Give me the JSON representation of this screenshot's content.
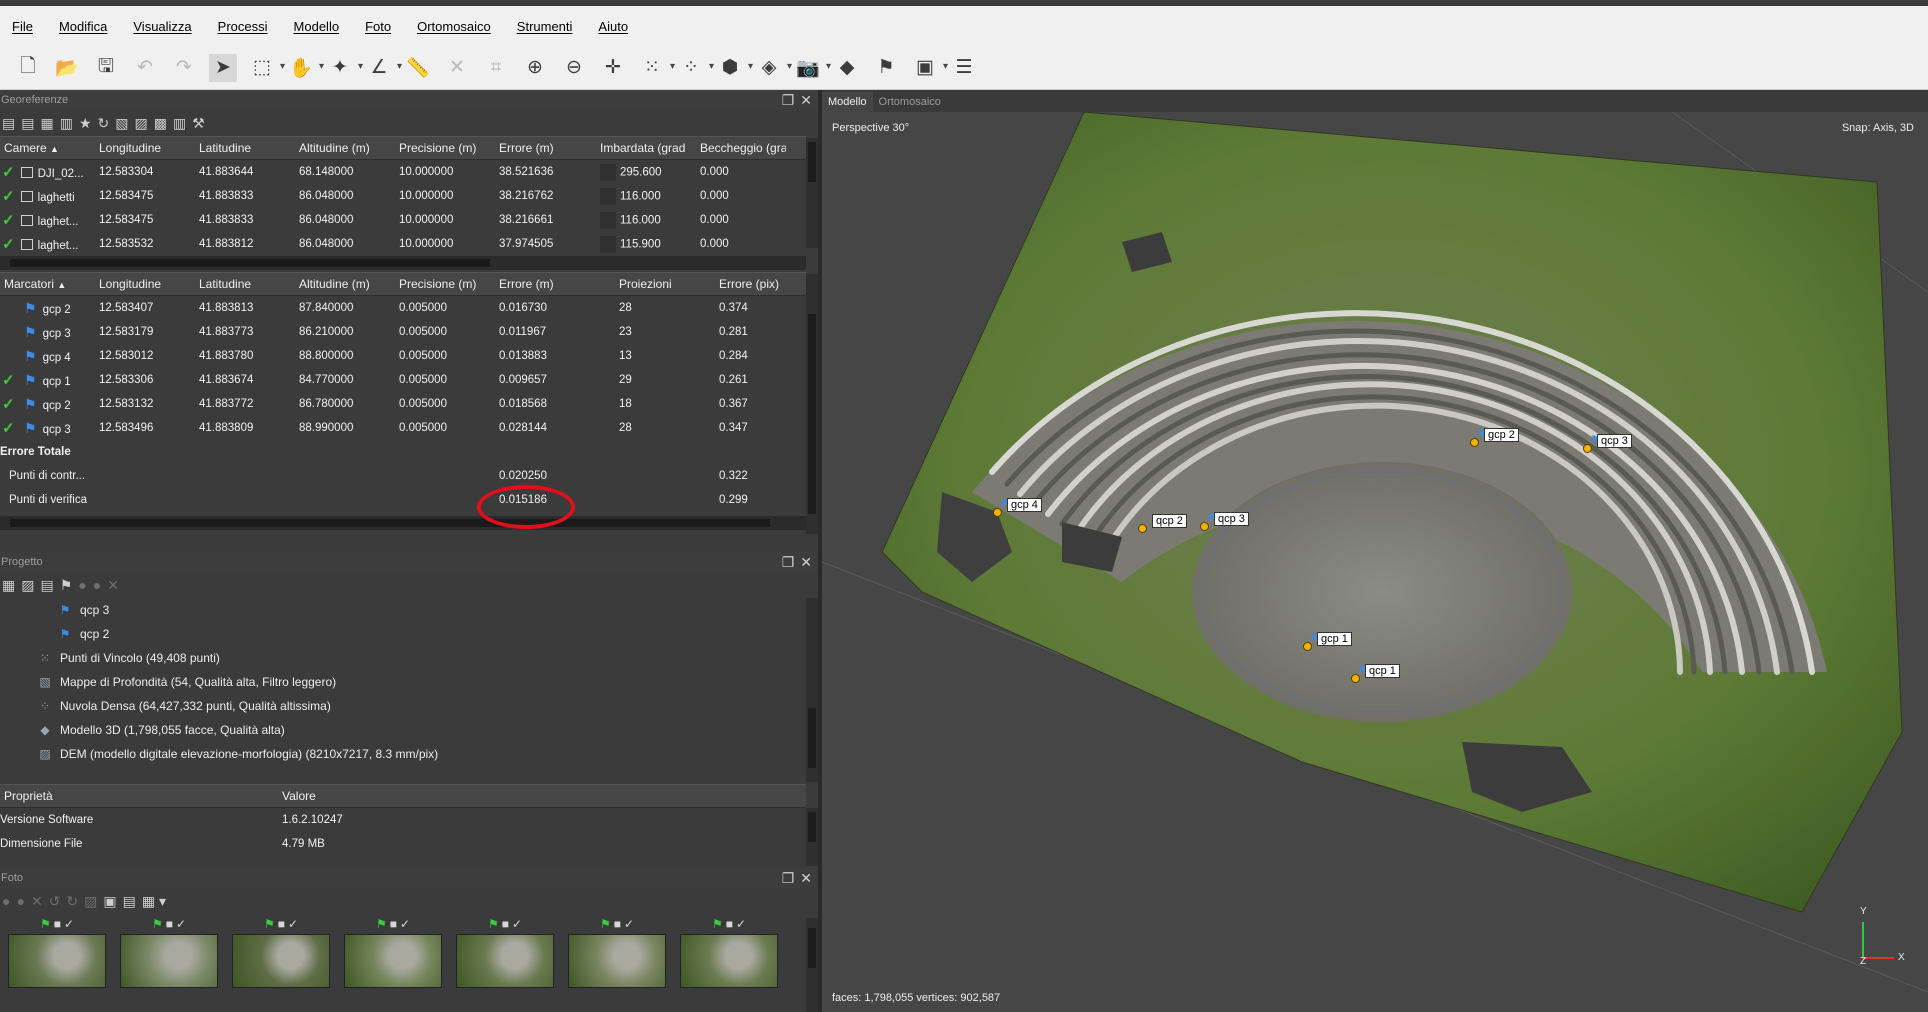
{
  "menu": [
    "File",
    "Modifica",
    "Visualizza",
    "Processi",
    "Modello",
    "Foto",
    "Ortomosaico",
    "Strumenti",
    "Aiuto"
  ],
  "toolbar_icons": [
    "new-file-icon",
    "open-folder-icon",
    "save-icon",
    "undo-icon",
    "redo-icon",
    "select-cursor-icon",
    "rectangle-select-icon",
    "hand-select-icon",
    "free-form-select-icon",
    "ruler-icon",
    "tape-measure-icon",
    "delete-icon",
    "crop-icon",
    "zoom-in-icon",
    "zoom-out-icon",
    "navigation-icon",
    "point-cloud-icon",
    "dense-cloud-icon",
    "mesh-shaded-icon",
    "mesh-wireframe-icon",
    "camera-icon",
    "ortho-icon",
    "markers-flag-icon",
    "dem-image-icon",
    "stack-icon"
  ],
  "georef": {
    "title": "Georeferenze",
    "cameras_headers": [
      "Camere",
      "Longitudine",
      "Latitudine",
      "Altitudine (m)",
      "Precisione (m)",
      "Errore (m)",
      "Imbardata (grad",
      "Beccheggio (gra"
    ],
    "cameras": [
      {
        "name": "DJI_02...",
        "lon": "12.583304",
        "lat": "41.883644",
        "alt": "68.148000",
        "prec": "10.000000",
        "err": "38.521636",
        "yaw": "295.600",
        "pitch": "0.000"
      },
      {
        "name": "laghetti",
        "lon": "12.583475",
        "lat": "41.883833",
        "alt": "86.048000",
        "prec": "10.000000",
        "err": "38.216762",
        "yaw": "116.000",
        "pitch": "0.000"
      },
      {
        "name": "laghet...",
        "lon": "12.583475",
        "lat": "41.883833",
        "alt": "86.048000",
        "prec": "10.000000",
        "err": "38.216661",
        "yaw": "116.000",
        "pitch": "0.000"
      },
      {
        "name": "laghet...",
        "lon": "12.583532",
        "lat": "41.883812",
        "alt": "86.048000",
        "prec": "10.000000",
        "err": "37.974505",
        "yaw": "115.900",
        "pitch": "0.000"
      }
    ],
    "markers_headers": [
      "Marcatori",
      "Longitudine",
      "Latitudine",
      "Altitudine (m)",
      "Precisione (m)",
      "Errore (m)",
      "Proiezioni",
      "Errore (pix)"
    ],
    "markers": [
      {
        "checked": false,
        "name": "gcp 2",
        "lon": "12.583407",
        "lat": "41.883813",
        "alt": "87.840000",
        "prec": "0.005000",
        "err": "0.016730",
        "proj": "28",
        "errpix": "0.374"
      },
      {
        "checked": false,
        "name": "gcp 3",
        "lon": "12.583179",
        "lat": "41.883773",
        "alt": "86.210000",
        "prec": "0.005000",
        "err": "0.011967",
        "proj": "23",
        "errpix": "0.281"
      },
      {
        "checked": false,
        "name": "gcp 4",
        "lon": "12.583012",
        "lat": "41.883780",
        "alt": "88.800000",
        "prec": "0.005000",
        "err": "0.013883",
        "proj": "13",
        "errpix": "0.284"
      },
      {
        "checked": true,
        "name": "qcp 1",
        "lon": "12.583306",
        "lat": "41.883674",
        "alt": "84.770000",
        "prec": "0.005000",
        "err": "0.009657",
        "proj": "29",
        "errpix": "0.261"
      },
      {
        "checked": true,
        "name": "qcp 2",
        "lon": "12.583132",
        "lat": "41.883772",
        "alt": "86.780000",
        "prec": "0.005000",
        "err": "0.018568",
        "proj": "18",
        "errpix": "0.367"
      },
      {
        "checked": true,
        "name": "qcp 3",
        "lon": "12.583496",
        "lat": "41.883809",
        "alt": "88.990000",
        "prec": "0.005000",
        "err": "0.028144",
        "proj": "28",
        "errpix": "0.347"
      }
    ],
    "total_label": "Errore Totale",
    "totals": [
      {
        "label": "Punti di contr...",
        "err": "0.020250",
        "errpix": "0.322"
      },
      {
        "label": "Punti di verifica",
        "err": "0.015186",
        "errpix": "0.299"
      }
    ]
  },
  "project": {
    "title": "Progetto",
    "items": [
      {
        "text": "qcp 3",
        "icon": "marker-flag-icon"
      },
      {
        "text": "qcp 2",
        "icon": "marker-flag-icon"
      },
      {
        "text": "Punti di Vincolo (49,408 punti)",
        "icon": "tie-points-icon"
      },
      {
        "text": "Mappe di Profondità (54, Qualità alta, Filtro leggero)",
        "icon": "depth-maps-icon"
      },
      {
        "text": "Nuvola Densa (64,427,332 punti, Qualità altissima)",
        "icon": "dense-cloud-icon"
      },
      {
        "text": "Modello 3D (1,798,055 facce, Qualità alta)",
        "icon": "model-icon"
      },
      {
        "text": "DEM (modello digitale elevazione-morfologia) (8210x7217, 8.3 mm/pix)",
        "icon": "dem-icon"
      }
    ]
  },
  "properties": {
    "headers": [
      "Proprietà",
      "Valore"
    ],
    "rows": [
      {
        "k": "Versione Software",
        "v": "1.6.2.10247"
      },
      {
        "k": "Dimensione File",
        "v": "4.79 MB"
      }
    ]
  },
  "photos": {
    "title": "Foto",
    "count": 7
  },
  "viewport": {
    "tabs": [
      "Modello",
      "Ortomosaico"
    ],
    "projection": "Perspective 30°",
    "snap": "Snap: Axis, 3D",
    "stats": "faces: 1,798,055 vertices: 902,587",
    "axis_y": "Y",
    "axis_z": "Z",
    "axis_x": "X",
    "markers": [
      "gcp 4",
      "qcp 2",
      "qcp 3",
      "gcp 2",
      "qcp 3",
      "gcp 1",
      "qcp 1"
    ]
  },
  "colors": {
    "highlight_circle": "#e0101a",
    "check": "#3fc83f",
    "flag": "#3a8be8",
    "marker_dot": "#f1b200"
  }
}
